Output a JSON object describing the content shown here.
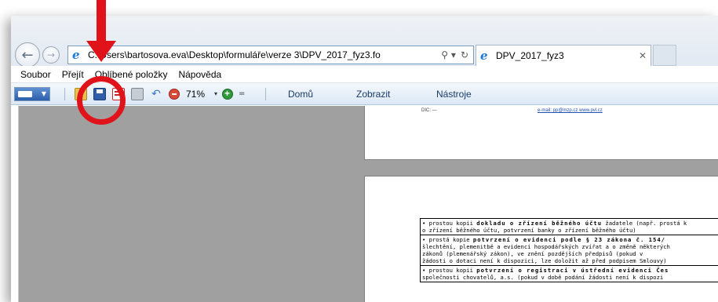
{
  "browser": {
    "address": "C:\\Users\\bartosova.eva\\Desktop\\formuláře\\verze 3\\DPV_2017_fyz3.fo",
    "address_visible": "C:\\Users\\bartosova.eva\\Desktop\\formuláře\\verze 3\\DPV_2017_fyz3.fo",
    "search_icon": "⚲ ▾",
    "refresh_icon": "↻",
    "tab_title": "DPV_2017_fyz3",
    "tab_close": "✕",
    "back_glyph": "←",
    "forward_glyph": "→"
  },
  "menu": {
    "items": [
      "Soubor",
      "Přejít",
      "Oblíbené položky",
      "Nápověda"
    ]
  },
  "toolbar": {
    "zoom": "71%",
    "zoom_arrow": "▾",
    "more_arrow": "=",
    "links": [
      "Domů",
      "Zobrazit",
      "Nástroje"
    ]
  },
  "document": {
    "page1_left": "DIC: —",
    "page1_right": "e-mail: pp@mzp.cz  www.pvl.cz",
    "rows": [
      {
        "line1_pre": "• prostou kopii ",
        "line1_bold": "dokladu o zřízení běžného účtu",
        "line1_post": " žadatele (např. prostá k",
        "line2": "o zřízení běžného účtu, potvrzení banky o zřízení běžného účtu)"
      },
      {
        "line1_pre": "• prostá kopie ",
        "line1_bold": "potvrzení o evidenci podle § 23 zákona č. 154/",
        "line1_post": "",
        "line2": "šlechtění, plemenitbě a evidenci hospodářských zvířat a o změně některých",
        "line3": "zákonů (plemenářský zákon), ve znění pozdějších předpisů (pokud v",
        "line4": "žádosti o dotaci není k dispozici, lze doložit až před podpisem Smlouvy)"
      },
      {
        "line1_pre": "• prostou kopii ",
        "line1_bold": "potvrzení o registraci v ústřední evidenci Čes",
        "line1_post": "",
        "line2": "společnosti chovatelů, a.s. (pokud v době podání žádosti není k dispozi"
      }
    ]
  },
  "annotation": {
    "color": "#e0131a"
  }
}
